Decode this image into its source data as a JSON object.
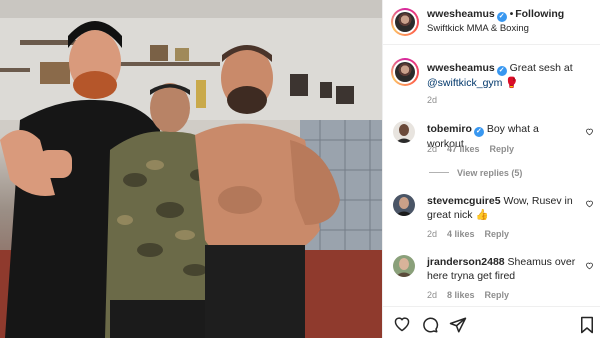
{
  "post": {
    "username": "wwesheamus",
    "follow_status": "Following",
    "location": "Swiftkick MMA & Boxing",
    "verified_mark": "✓",
    "separator": "•"
  },
  "caption": {
    "username": "wwesheamus",
    "text": "Great sesh at",
    "mention": "@swiftkick_gym",
    "emoji": "🥊",
    "age": "2d"
  },
  "comments": [
    {
      "username": "tobemiro",
      "verified": true,
      "text": "Boy what a workout",
      "age": "2d",
      "likes": "47 likes",
      "reply": "Reply"
    },
    {
      "username": "stevemcguire5",
      "verified": false,
      "text": "Wow, Rusev in great nick 👍",
      "age": "2d",
      "likes": "4 likes",
      "reply": "Reply"
    },
    {
      "username": "jranderson2488",
      "verified": false,
      "text": "Sheamus over here tryna get fired",
      "age": "2d",
      "likes": "8 likes",
      "reply": "Reply"
    }
  ],
  "view_replies": "View replies (5)",
  "icons": {
    "like": "heart-icon",
    "comment": "comment-icon",
    "share": "share-icon",
    "save": "bookmark-icon"
  },
  "colors": {
    "verified": "#3897f0",
    "meta": "#8e8e8e",
    "text": "#262626"
  }
}
